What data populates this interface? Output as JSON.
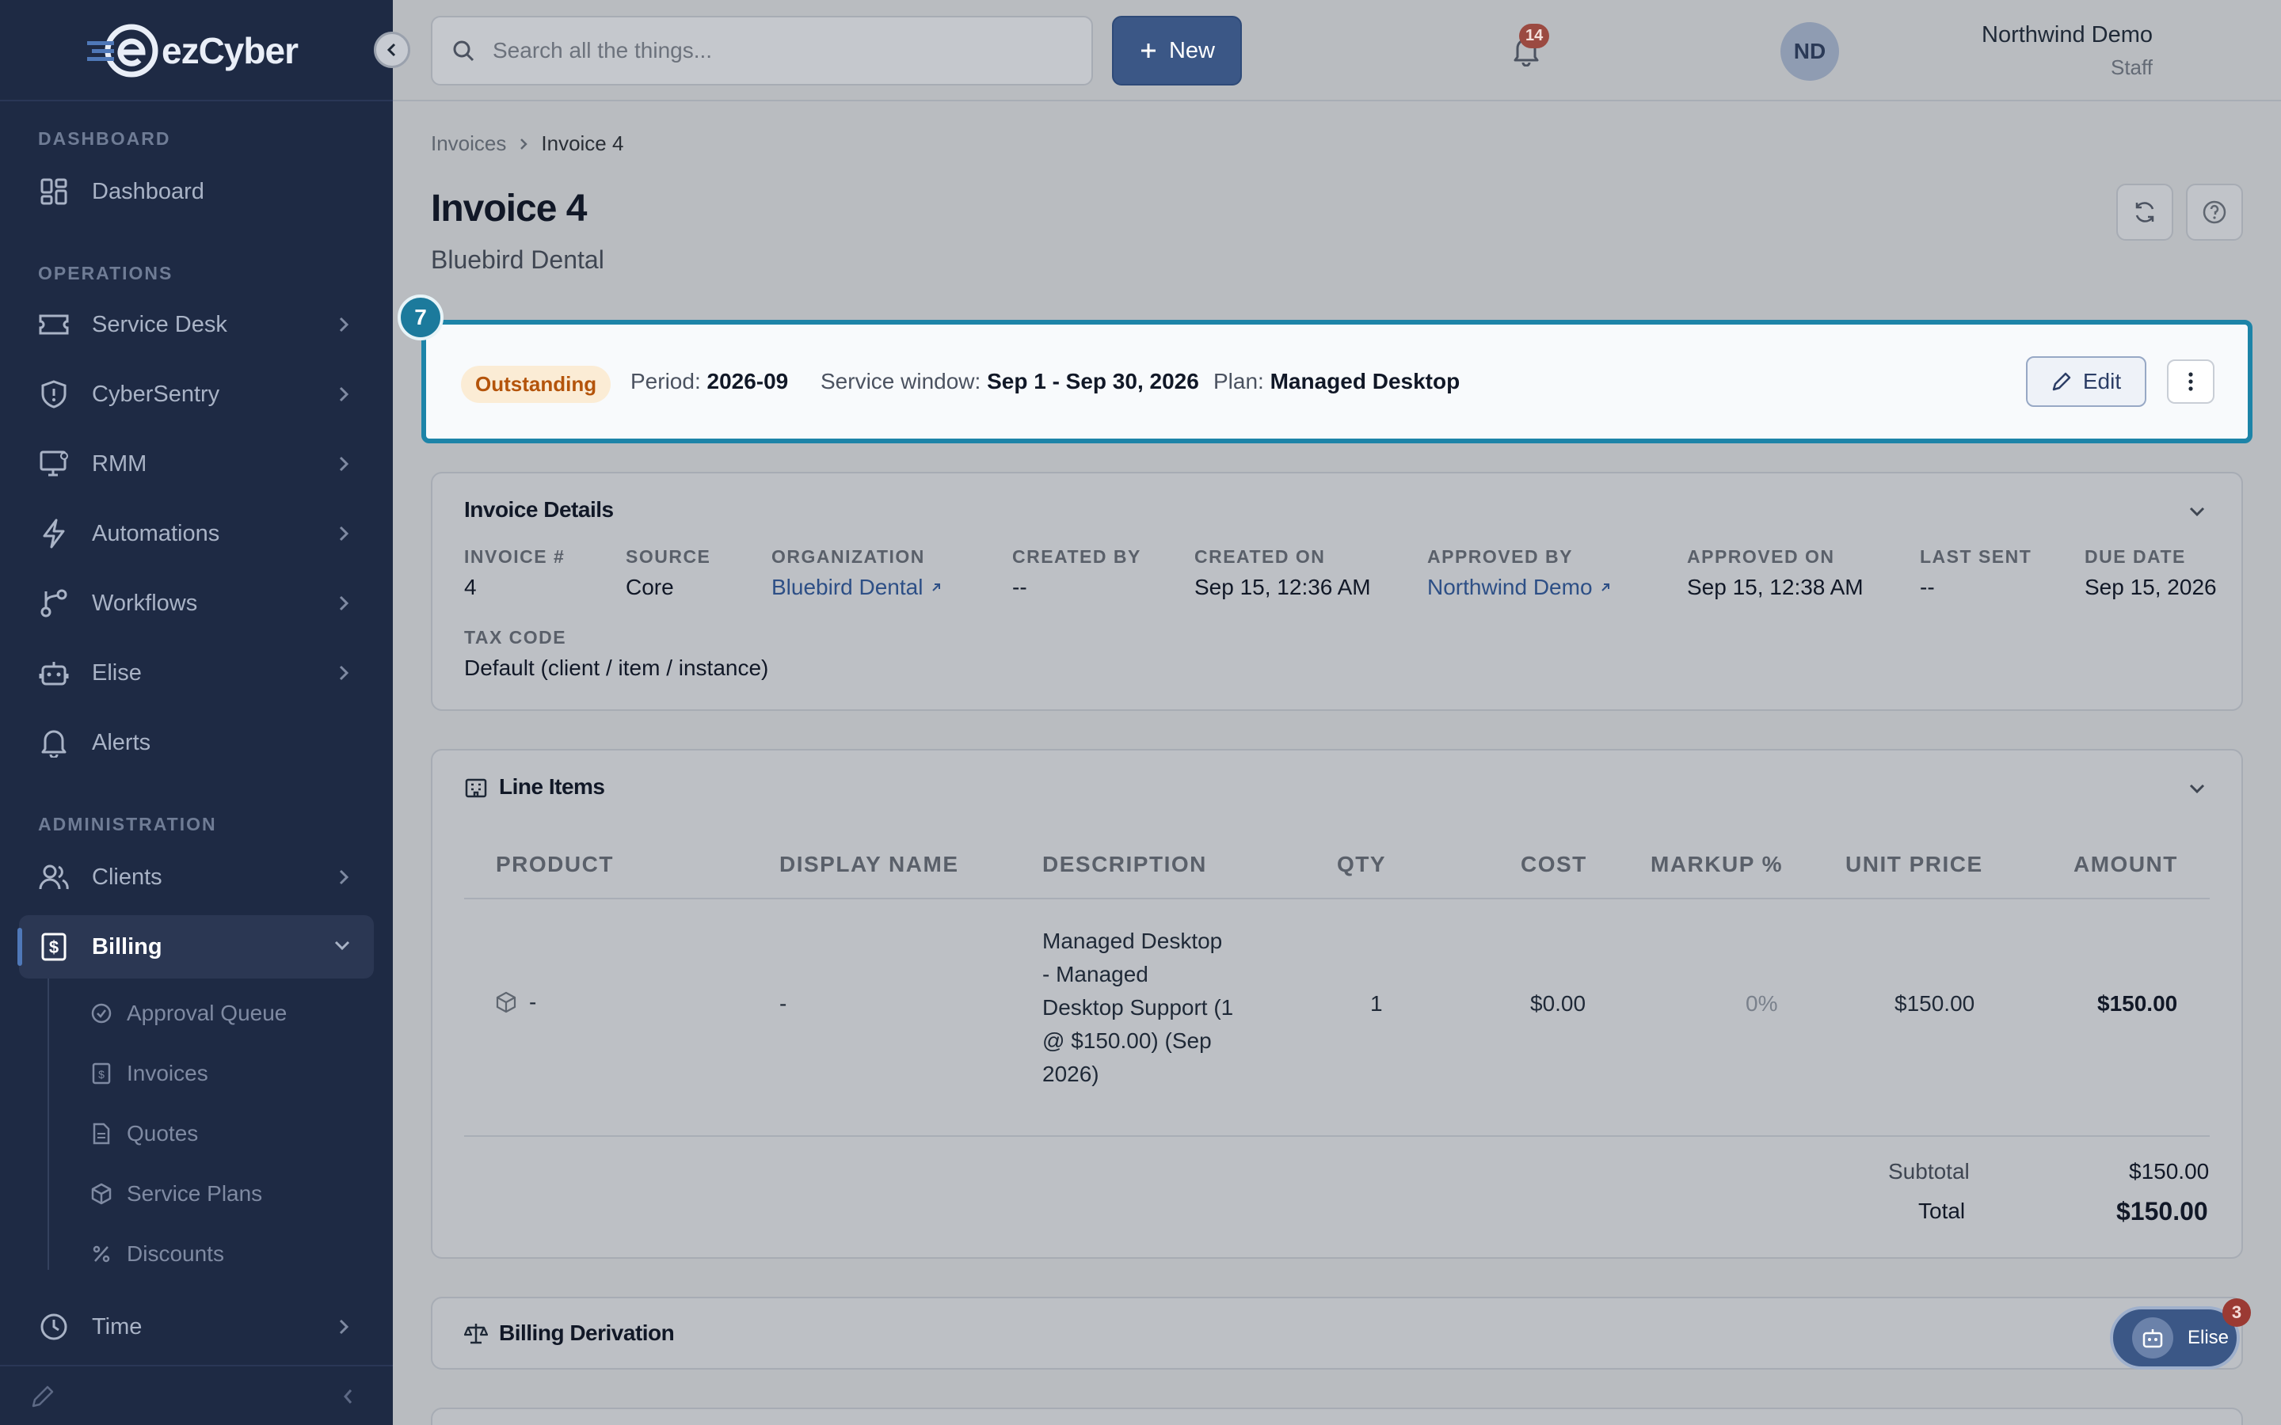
{
  "app": {
    "name": "ezCyber"
  },
  "sidebar": {
    "sections": {
      "dashboard": "DASHBOARD",
      "operations": "OPERATIONS",
      "administration": "ADMINISTRATION"
    },
    "items": {
      "dashboard": "Dashboard",
      "service_desk": "Service Desk",
      "cybersentry": "CyberSentry",
      "rmm": "RMM",
      "automations": "Automations",
      "workflows": "Workflows",
      "elise": "Elise",
      "alerts": "Alerts",
      "clients": "Clients",
      "billing": "Billing",
      "time": "Time"
    },
    "billing_sub": {
      "approval_queue": "Approval Queue",
      "invoices": "Invoices",
      "quotes": "Quotes",
      "service_plans": "Service Plans",
      "discounts": "Discounts"
    }
  },
  "topbar": {
    "search_placeholder": "Search all the things...",
    "new_label": "New",
    "notification_count": "14",
    "user_name": "Northwind Demo",
    "user_role": "Staff",
    "avatar_initials": "ND"
  },
  "breadcrumb": {
    "parent": "Invoices",
    "current": "Invoice 4"
  },
  "page": {
    "title": "Invoice 4",
    "subtitle": "Bluebird Dental"
  },
  "summary": {
    "step": "7",
    "status": "Outstanding",
    "period_label": "Period:",
    "period": "2026-09",
    "window_label": "Service window:",
    "window": "Sep 1 - Sep 30, 2026",
    "plan_label": "Plan:",
    "plan": "Managed Desktop",
    "edit_label": "Edit"
  },
  "details": {
    "title": "Invoice Details",
    "labels": {
      "invoice_no": "INVOICE #",
      "source": "SOURCE",
      "organization": "ORGANIZATION",
      "created_by": "CREATED BY",
      "created_on": "CREATED ON",
      "approved_by": "APPROVED BY",
      "approved_on": "APPROVED ON",
      "last_sent": "LAST SENT",
      "due_date": "DUE DATE",
      "tax_code": "TAX CODE"
    },
    "values": {
      "invoice_no": "4",
      "source": "Core",
      "organization": "Bluebird Dental",
      "created_by": "--",
      "created_on": "Sep 15, 12:36 AM",
      "approved_by": "Northwind Demo",
      "approved_on": "Sep 15, 12:38 AM",
      "last_sent": "--",
      "due_date": "Sep 15, 2026",
      "tax_code": "Default (client / item / instance)"
    }
  },
  "line_items": {
    "title": "Line Items",
    "columns": [
      "PRODUCT",
      "DISPLAY NAME",
      "DESCRIPTION",
      "QTY",
      "COST",
      "MARKUP %",
      "UNIT PRICE",
      "AMOUNT"
    ],
    "rows": [
      {
        "product": "-",
        "display_name": "-",
        "description_lines": [
          "Managed Desktop",
          "- Managed",
          "Desktop Support (1",
          "@ $150.00) (Sep",
          "2026)"
        ],
        "qty": "1",
        "cost": "$0.00",
        "markup": "0%",
        "unit_price": "$150.00",
        "amount": "$150.00"
      }
    ],
    "subtotal_label": "Subtotal",
    "subtotal": "$150.00",
    "total_label": "Total",
    "total": "$150.00"
  },
  "billing_derivation": {
    "title": "Billing Derivation"
  },
  "assistant": {
    "label": "Elise",
    "badge": "3"
  }
}
